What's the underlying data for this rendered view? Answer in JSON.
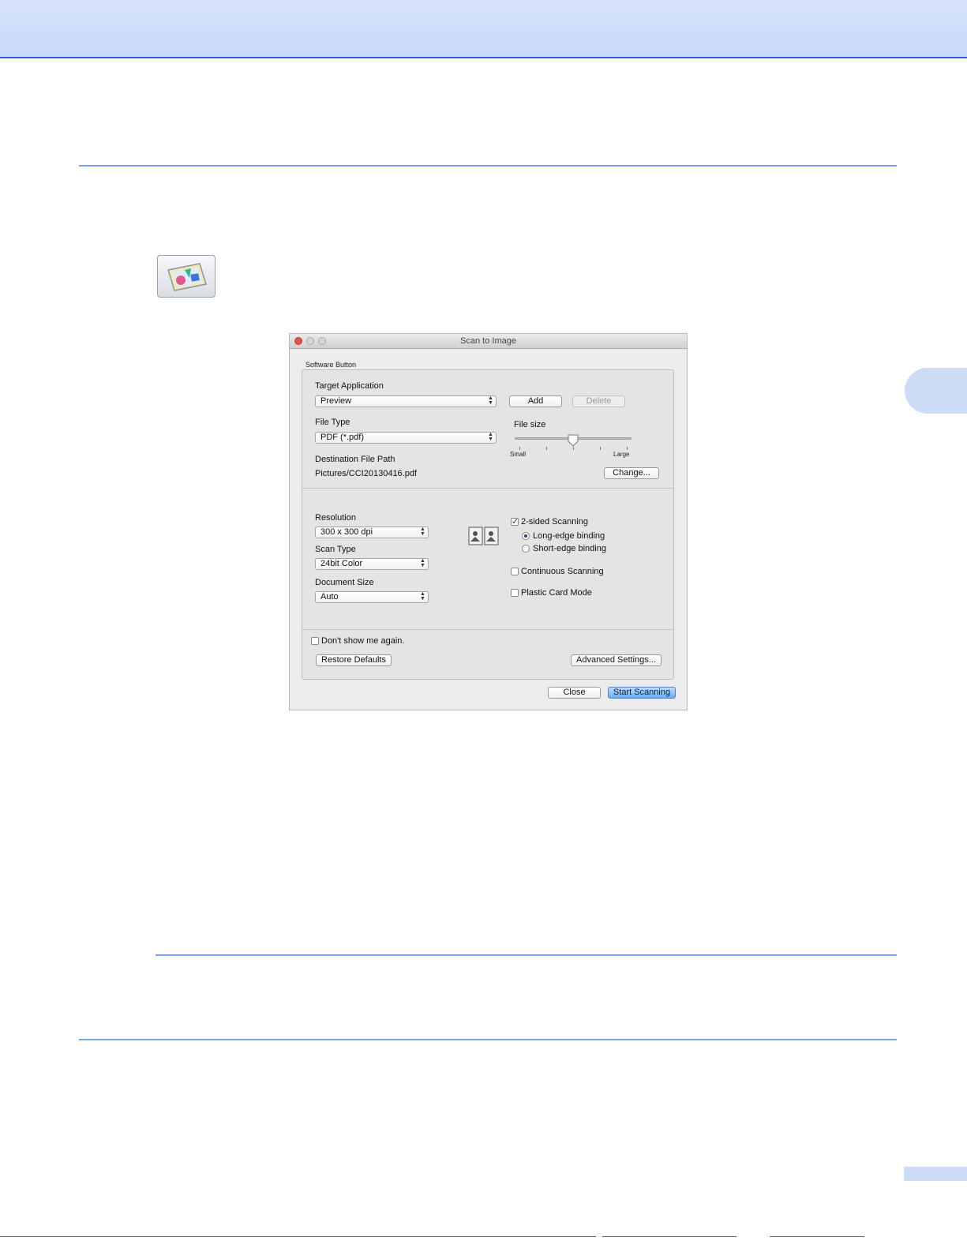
{
  "dialog": {
    "title": "Scan to Image",
    "group_label": "Software Button",
    "target_application": {
      "label": "Target Application",
      "value": "Preview",
      "add_label": "Add",
      "delete_label": "Delete"
    },
    "file_type": {
      "label": "File Type",
      "value": "PDF (*.pdf)"
    },
    "file_size": {
      "label": "File size",
      "min_label": "Small",
      "max_label": "Large",
      "level": 0.5
    },
    "destination": {
      "label": "Destination File Path",
      "value": "Pictures/CCI20130416.pdf",
      "change_label": "Change..."
    },
    "resolution": {
      "label": "Resolution",
      "value": "300 x 300 dpi"
    },
    "scan_type": {
      "label": "Scan Type",
      "value": "24bit Color"
    },
    "document_size": {
      "label": "Document Size",
      "value": "Auto"
    },
    "two_sided": {
      "label": "2-sided Scanning",
      "checked": true,
      "long_edge_label": "Long-edge binding",
      "short_edge_label": "Short-edge binding",
      "selected": "long"
    },
    "continuous": {
      "label": "Continuous Scanning",
      "checked": false
    },
    "plastic_card": {
      "label": "Plastic Card Mode",
      "checked": false
    },
    "dont_show": {
      "label": "Don't show me again.",
      "checked": false
    },
    "restore_label": "Restore Defaults",
    "advanced_label": "Advanced Settings...",
    "close_label": "Close",
    "start_label": "Start Scanning"
  },
  "icons": {
    "app_icon": "scan-to-image-icon",
    "duplex_icon": "duplex-binding-icon",
    "check_mark": "✓"
  }
}
